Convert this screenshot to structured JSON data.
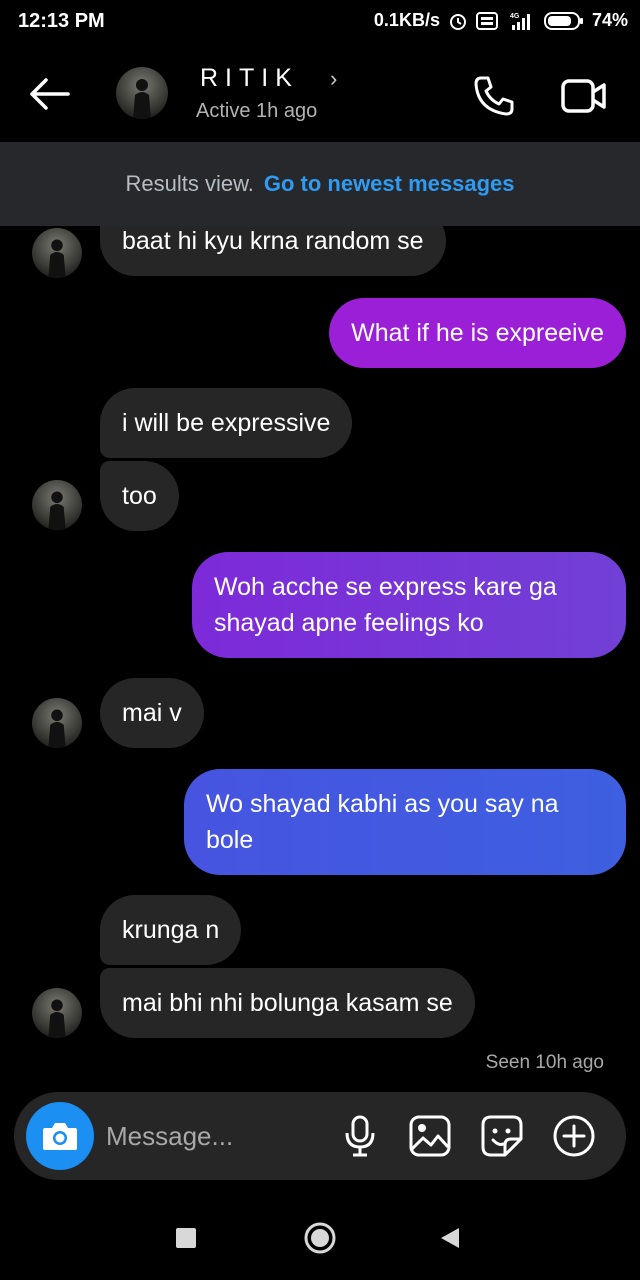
{
  "status_bar": {
    "time": "12:13 PM",
    "network_speed": "0.1KB/s",
    "battery": "74%",
    "icons": [
      "alarm-icon",
      "volte-icon",
      "signal-icon",
      "battery-icon"
    ]
  },
  "header": {
    "contact_name": "RITIK",
    "chevron": "›",
    "active_status": "Active 1h ago",
    "icons": [
      "back-arrow-icon",
      "phone-icon",
      "video-camera-icon"
    ]
  },
  "banner": {
    "text": "Results view.",
    "link": "Go to newest messages"
  },
  "messages": [
    {
      "side": "in",
      "text": "baat hi kyu krna random se",
      "avatar": true
    },
    {
      "side": "out",
      "text": "What if he is expreeive",
      "color": "#9b1fd6"
    },
    {
      "side": "in",
      "text": "i will be expressive",
      "avatar": false
    },
    {
      "side": "in",
      "text": "too",
      "avatar": true
    },
    {
      "side": "out",
      "text": "Woh acche se express kare ga\nshayad apne feelings ko",
      "color": "#7b2ed8"
    },
    {
      "side": "in",
      "text": "mai v",
      "avatar": true
    },
    {
      "side": "out",
      "text": "Wo shayad kabhi as you say na\nbole",
      "color": "#3f5be0"
    },
    {
      "side": "in",
      "text": "krunga n",
      "avatar": false
    },
    {
      "side": "in",
      "text": "mai bhi nhi bolunga kasam se",
      "avatar": true
    }
  ],
  "seen_label": "Seen 10h ago",
  "composer": {
    "placeholder": "Message...",
    "icons": [
      "camera-icon",
      "microphone-icon",
      "gallery-icon",
      "sticker-icon",
      "plus-icon"
    ]
  },
  "navbar": {
    "icons": [
      "recents-square-icon",
      "home-circle-icon",
      "back-triangle-icon"
    ]
  },
  "colors": {
    "incoming_bubble": "#262626",
    "banner_bg": "#26282b",
    "link": "#2f9bf2",
    "camera_button": "#1b8ff2"
  }
}
